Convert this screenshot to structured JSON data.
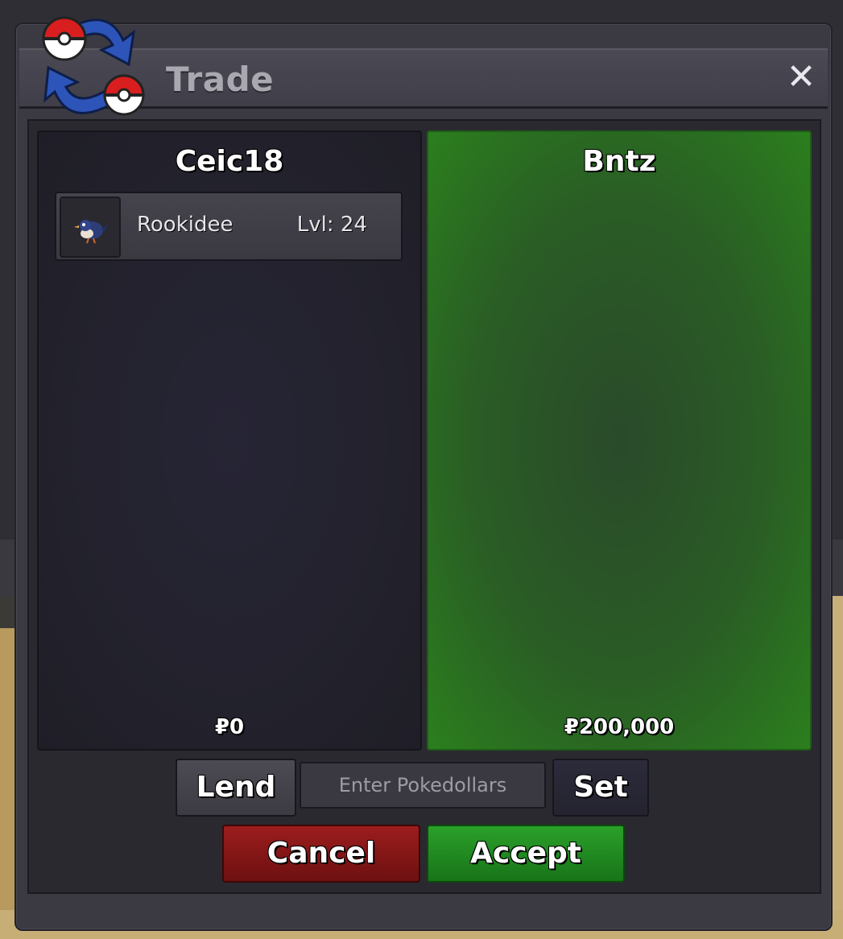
{
  "window": {
    "title": "Trade",
    "close_icon": "close-icon",
    "trade_icon": "trade-swap-icon"
  },
  "left_panel": {
    "player_name": "Ceic18",
    "items": [
      {
        "name": "Rookidee",
        "level": "Lvl: 24",
        "icon": "rookidee-sprite-icon"
      }
    ],
    "money": "₽0"
  },
  "right_panel": {
    "player_name": "Bntz",
    "items": [],
    "money": "₽200,000",
    "accepted_color": "#2b7f1d"
  },
  "controls": {
    "lend_label": "Lend",
    "money_placeholder": "Enter Pokedollars",
    "set_label": "Set",
    "cancel_label": "Cancel",
    "accept_label": "Accept"
  },
  "colors": {
    "cancel": "#9c1d1d",
    "accept": "#2aa02a"
  }
}
